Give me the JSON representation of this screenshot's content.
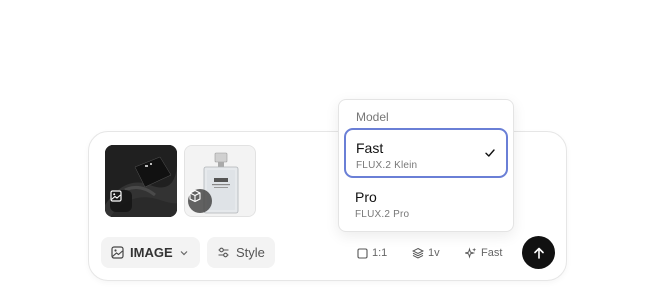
{
  "dropdown": {
    "title": "Model",
    "options": [
      {
        "name": "Fast",
        "model": "FLUX.2 Klein",
        "selected": true
      },
      {
        "name": "Pro",
        "model": "FLUX.2 Pro",
        "selected": false
      }
    ]
  },
  "composer": {
    "attachments": [
      {
        "kind": "image",
        "badge_icon": "image-icon"
      },
      {
        "kind": "product",
        "badge_icon": "cube-icon"
      }
    ],
    "mode_button": {
      "label": "IMAGE",
      "icon": "image-icon"
    },
    "style_button": {
      "label": "Style",
      "icon": "sliders-icon"
    },
    "aspect_ratio": {
      "label": "1:1",
      "icon": "square-icon"
    },
    "versions": {
      "label": "1v",
      "icon": "layers-icon"
    },
    "speed": {
      "label": "Fast",
      "icon": "sparkle-icon"
    },
    "send_icon": "arrow-up-icon"
  },
  "colors": {
    "accent_border": "#6a7fd6",
    "send_button": "#111111",
    "pill_background": "#f3f3f3"
  }
}
